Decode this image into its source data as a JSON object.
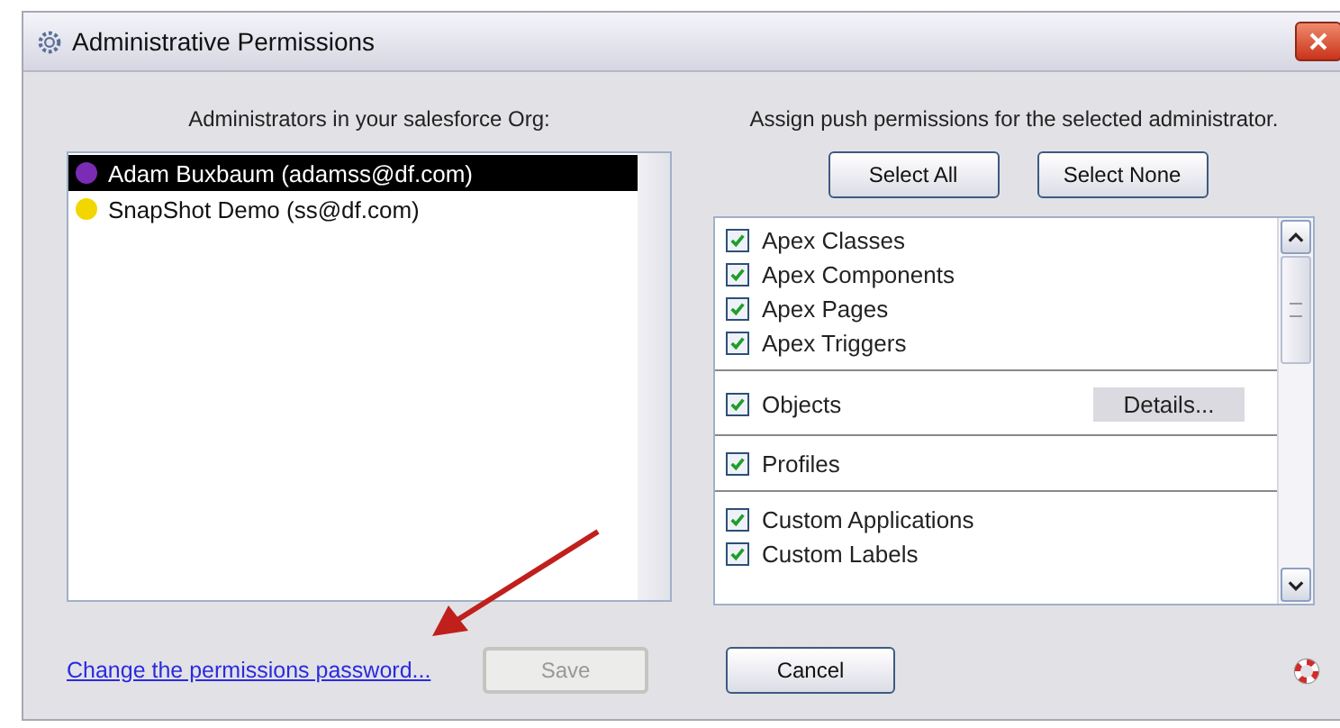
{
  "window": {
    "title": "Administrative Permissions"
  },
  "administrators": {
    "heading": "Administrators in your salesforce Org:",
    "items": [
      {
        "label": "Adam Buxbaum (adamss@df.com)",
        "selected": true,
        "color": "#7a2cb4"
      },
      {
        "label": "SnapShot Demo (ss@df.com)",
        "selected": false,
        "color": "#f2d600"
      }
    ]
  },
  "permissions": {
    "heading": "Assign push permissions for the selected administrator.",
    "buttons": [
      "Select All",
      "Select None"
    ],
    "groups": [
      {
        "items": [
          {
            "label": "Apex Classes",
            "checked": true
          },
          {
            "label": "Apex Components",
            "checked": true
          },
          {
            "label": "Apex Pages",
            "checked": true
          },
          {
            "label": "Apex Triggers",
            "checked": true
          }
        ]
      },
      {
        "items": [
          {
            "label": "Objects",
            "checked": true,
            "button": "Details..."
          }
        ]
      },
      {
        "items": [
          {
            "label": "Profiles",
            "checked": true
          }
        ]
      },
      {
        "items": [
          {
            "label": "Custom Applications",
            "checked": true
          },
          {
            "label": "Custom Labels",
            "checked": true
          }
        ]
      }
    ]
  },
  "footer": {
    "link": "Change the permissions password...",
    "save": {
      "label": "Save",
      "disabled": true
    },
    "cancel": {
      "label": "Cancel",
      "disabled": false
    }
  }
}
